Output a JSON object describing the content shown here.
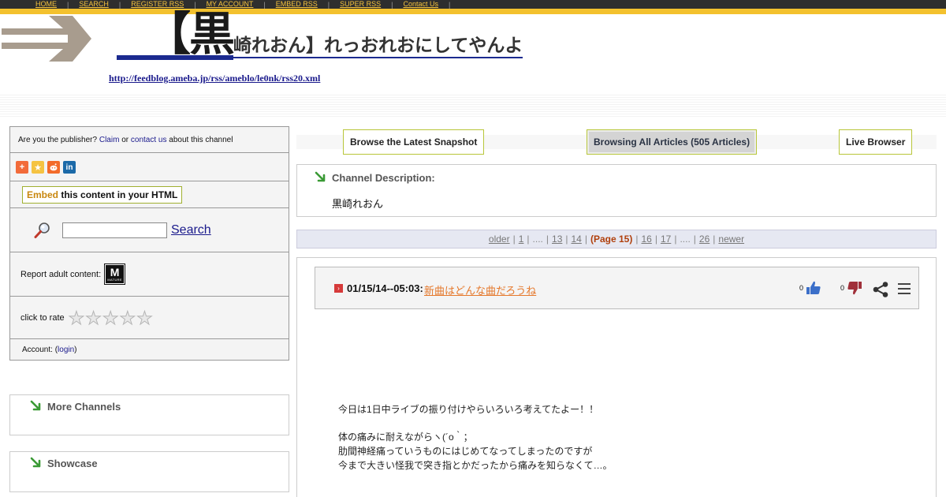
{
  "nav": {
    "items": [
      "HOME",
      "SEARCH",
      "REGISTER RSS",
      "MY ACCOUNT",
      "EMBED RSS",
      "SUPER RSS",
      "Contact Us"
    ]
  },
  "header": {
    "title_first": "【黒",
    "title_rest": "崎れおん】れっおれおにしてやんよ",
    "feed_url": "http://feedblog.ameba.jp/rss/ameblo/le0nk/rss20.xml"
  },
  "sidebar": {
    "publisher_q": "Are you the publisher?",
    "claim_label": "Claim",
    "or_text": "or",
    "contact_label": "contact us",
    "about_text": "about this channel",
    "share_icons": [
      "addthis-icon",
      "favorites-icon",
      "reddit-icon",
      "linkedin-icon"
    ],
    "embed_hl": "Embed",
    "embed_rest": "this content in your HTML",
    "search_label": "Search",
    "adult_label": "Report adult content:",
    "mature_m": "M",
    "mature_t": "MATURE",
    "rate_label": "click to rate",
    "rating_stars": 5,
    "account_label": "Account: (",
    "login_label": "login",
    "account_close": ")"
  },
  "panels": {
    "more_channels": "More Channels",
    "showcase": "Showcase"
  },
  "tabs": {
    "latest": "Browse the Latest Snapshot",
    "all": "Browsing All Articles (505 Articles)",
    "live": "Live Browser"
  },
  "channel": {
    "desc_title": "Channel Description:",
    "desc_text": "黒崎れおん"
  },
  "pager": {
    "older": "older",
    "p1": "1",
    "dots1": "....",
    "p13": "13",
    "p14": "14",
    "current": "(Page 15)",
    "p16": "16",
    "p17": "17",
    "dots2": "....",
    "p26": "26",
    "newer": "newer",
    "sep": "|"
  },
  "article": {
    "date": "01/15/14--05:03:",
    "title": "新曲はどんな曲だろうね",
    "likes": "0",
    "dislikes": "0",
    "body": [
      "今日は1日中ライブの振り付けやらいろいろ考えてたよー！！",
      "",
      "体の痛みに耐えながらヽ(´o｀；",
      "肋間神経痛っていうものにはじめてなってしまったのですが",
      "今まで大きい怪我で突き指とかだったから痛みを知らなくて…。"
    ]
  },
  "colors": {
    "nav_bg": "#2e2e2e",
    "nav_text": "#f6c33c",
    "gold_bar": "#f3c12e",
    "title_underline": "#1b2a8f",
    "link": "#1a1a8c",
    "article_title": "#e5782b",
    "current_page": "#b0400d",
    "tab_border": "#b8c63a"
  }
}
